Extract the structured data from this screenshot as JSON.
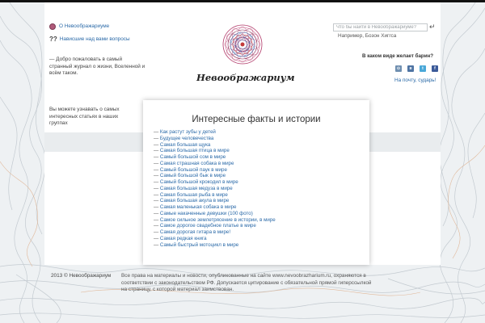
{
  "header": {
    "about_label": "О Невоображариуме",
    "faq_label": "Нависшие над вами вопросы",
    "faq_mark": "??",
    "welcome_text": "— Добро пожаловать в самый странный журнал о жизни, Вселенной и всём таком.",
    "groups_text": "Вы можете узнавать о самых интересных статьях в наших группах"
  },
  "logo": {
    "title": "Невоображариум"
  },
  "search": {
    "placeholder": "Что бы найти в Невоображариуме?",
    "go_icon": "↵",
    "hint": "Например, Бозон Хиггса"
  },
  "share": {
    "question": "В каком виде желает барин?",
    "icons": [
      {
        "name": "rss-icon",
        "glyph": "⊙",
        "color": "#6f8fb0"
      },
      {
        "name": "vk-icon",
        "glyph": "в",
        "color": "#4f74a3"
      },
      {
        "name": "twitter-icon",
        "glyph": "t",
        "color": "#4aa8d8"
      },
      {
        "name": "facebook-icon",
        "glyph": "f",
        "color": "#3b5a99"
      }
    ],
    "mail_label": "На почту, сударь!"
  },
  "card": {
    "title": "Интересные факты и истории",
    "items": [
      "Как растут зубы у детей",
      "Будущее человечества",
      "Самая большая щука",
      "Самая большая птица в мире",
      "Самый большой сом в мире",
      "Самая страшная собака в мире",
      "Самый большой паук в мире",
      "Самый большой бык в мире",
      "Самый большой крокодил в мире",
      "Самая большая медуза в мире",
      "Самая большая рыба в мире",
      "Самая большая акула в мире",
      "Самая маленькая собака в мире",
      "Самые накаченные девушки (100 фото)",
      "Самое сильное землетрясение в истории, в мире",
      "Самое дорогое свадебное платье в мире",
      "Самая дорогая гитара в мире!",
      "Самая редкая книга",
      "Самый быстрый мотоцикл в мире"
    ]
  },
  "footer": {
    "copyright": "2013 © Невоображариум",
    "rights": "Все права на материалы и новости, опубликованные на сайте www.nevoobrazharium.ru, охраняются в соответствии с законодательством РФ. Допускается цитирование с обязательной прямой гиперссылкой на страницу, с которой материал заимствован."
  }
}
